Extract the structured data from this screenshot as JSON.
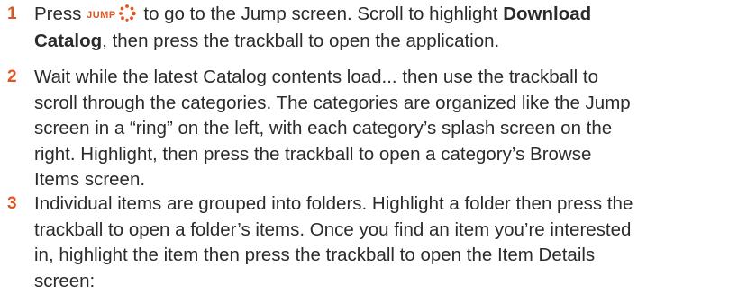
{
  "steps": [
    {
      "number": "1",
      "line1_before": "Press ",
      "jump_key": "JUMP",
      "line1_after": " to go to the Jump screen. Scroll to highlight ",
      "line1_bold": "Download",
      "line2_bold": "Catalog",
      "line2_after": ", then press the trackball to open the application."
    },
    {
      "number": "2",
      "lines": [
        "Wait while the latest Catalog contents load... then use the trackball to",
        "scroll through the categories. The categories are organized like the Jump",
        "screen in a “ring” on the left, with each category’s splash screen on the",
        "right. Highlight, then press the trackball to open a category’s Browse",
        "Items screen."
      ]
    },
    {
      "number": "3",
      "lines": [
        "Individual items are grouped into folders. Highlight a folder then press the",
        "trackball to open a folder’s items. Once you find an item you’re interested",
        "in, highlight the item then press the trackball to open the Item Details",
        "screen:"
      ]
    }
  ],
  "icons": {
    "jump": "jump-dots-icon"
  },
  "colors": {
    "accent": "#e0551f",
    "text": "#2b2b2b"
  }
}
